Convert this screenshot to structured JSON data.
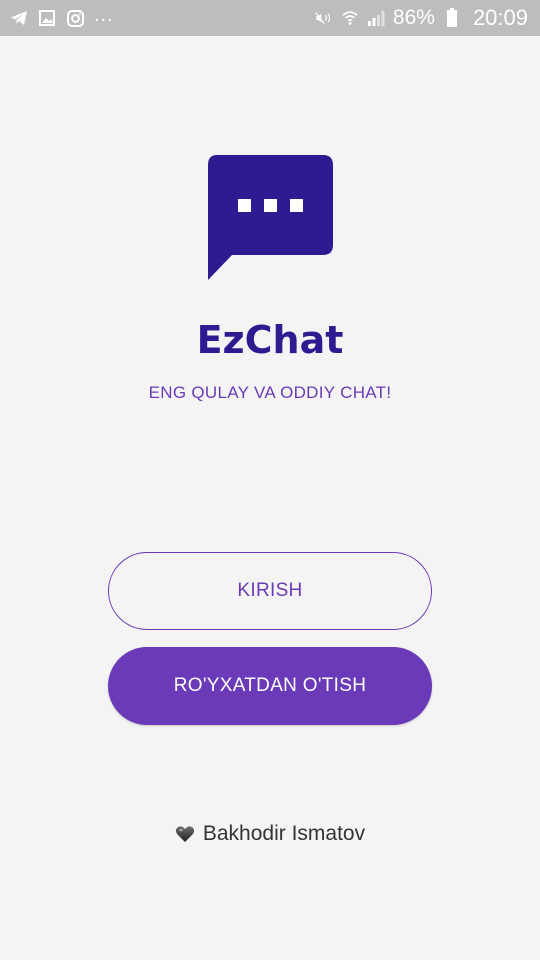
{
  "status_bar": {
    "left_icons": [
      "telegram-icon",
      "gallery-icon",
      "instagram-icon"
    ],
    "overflow": "...",
    "right_icons": [
      "mute-icon",
      "wifi-icon",
      "signal-icon",
      "battery-icon"
    ],
    "battery_percent": "86%",
    "time": "20:09"
  },
  "app": {
    "logo_icon": "chat-bubble-icon",
    "brand_color": "#2e1a91",
    "accent_color": "#6a3ab8",
    "title": "EzChat",
    "tagline": "ENG QULAY VA ODDIY CHAT!"
  },
  "buttons": {
    "login_label": "KIRISH",
    "register_label": "RO'YXATDAN O'TISH"
  },
  "footer": {
    "heart_icon": "heart-icon",
    "author": "Bakhodir Ismatov"
  }
}
